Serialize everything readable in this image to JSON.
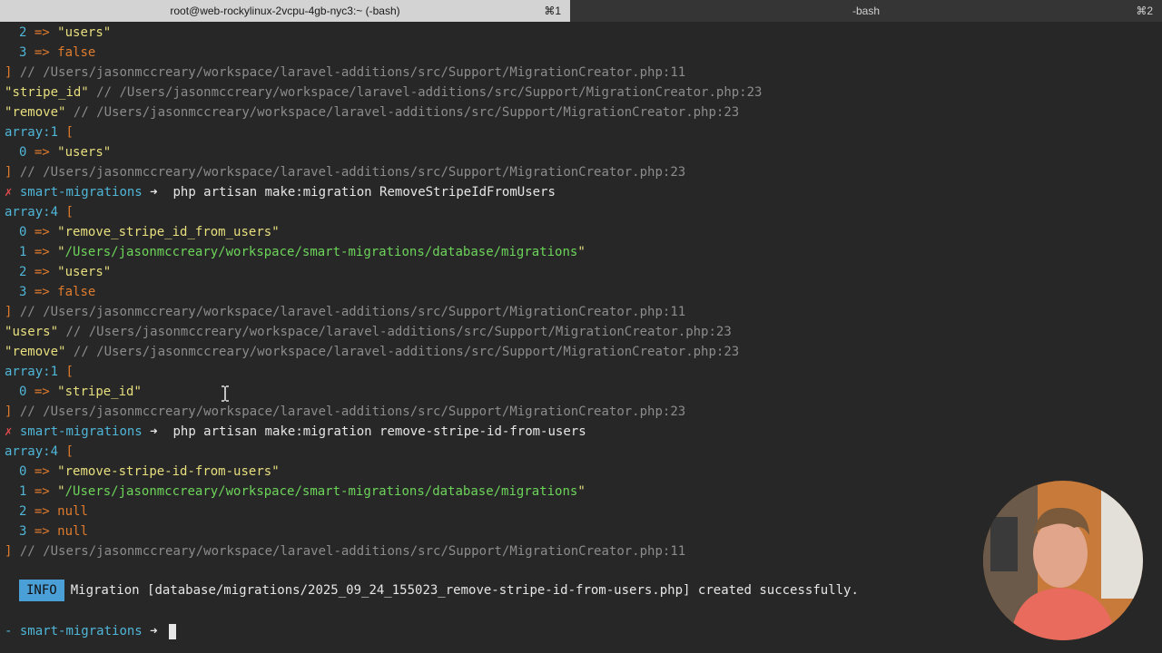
{
  "tabs": [
    {
      "title": "root@web-rockylinux-2vcpu-4gb-nyc3:~ (-bash)",
      "shortcut": "⌘1"
    },
    {
      "title": "-bash",
      "shortcut": "⌘2"
    }
  ],
  "terminal": {
    "l01": {
      "idx": "2",
      "val": "users"
    },
    "l02": {
      "idx": "3",
      "val": "false"
    },
    "comment_11": "// /Users/jasonmccreary/workspace/laravel-additions/src/Support/MigrationCreator.php:11",
    "comment_23": "// /Users/jasonmccreary/workspace/laravel-additions/src/Support/MigrationCreator.php:23",
    "l04_str": "stripe_id",
    "l05_str": "remove",
    "array1": "array:1",
    "array4": "array:4",
    "l07": {
      "idx": "0",
      "val": "users"
    },
    "prompt_name": "smart-migrations",
    "prompt_arrow": "➜",
    "cmd1": "php artisan make:migration RemoveStripeIdFromUsers",
    "l11": {
      "idx": "0",
      "val": "remove_stripe_id_from_users"
    },
    "l12": {
      "idx": "1",
      "val": "/Users/jasonmccreary/workspace/smart-migrations/database/migrations"
    },
    "l13": {
      "idx": "2",
      "val": "users"
    },
    "l14": {
      "idx": "3",
      "val": "false"
    },
    "l16_str": "users",
    "l17_str": "remove",
    "l19": {
      "idx": "0",
      "val": "stripe_id"
    },
    "cmd2": "php artisan make:migration remove-stripe-id-from-users",
    "l23": {
      "idx": "0",
      "val": "remove-stripe-id-from-users"
    },
    "l24": {
      "idx": "1",
      "val": "/Users/jasonmccreary/workspace/smart-migrations/database/migrations"
    },
    "l25": {
      "idx": "2",
      "val": "null"
    },
    "l26": {
      "idx": "3",
      "val": "null"
    },
    "info_badge": "INFO",
    "info_pre": "Migration",
    "info_file": "[database/migrations/2025_09_24_155023_remove-stripe-id-from-users.php]",
    "info_post": "created successfully.",
    "arrow": "=>",
    "open_bracket": "[",
    "close_bracket": "]",
    "x_mark": "✗",
    "dash_mark": "-"
  },
  "colors": {
    "background": "#272727",
    "string": "#e8df7e",
    "path": "#6dd45a",
    "keyword": "#e07b2d",
    "index": "#4fb6d8",
    "comment": "#8c8c8c",
    "error": "#e24b4b",
    "info_badge": "#4a9fd6"
  }
}
